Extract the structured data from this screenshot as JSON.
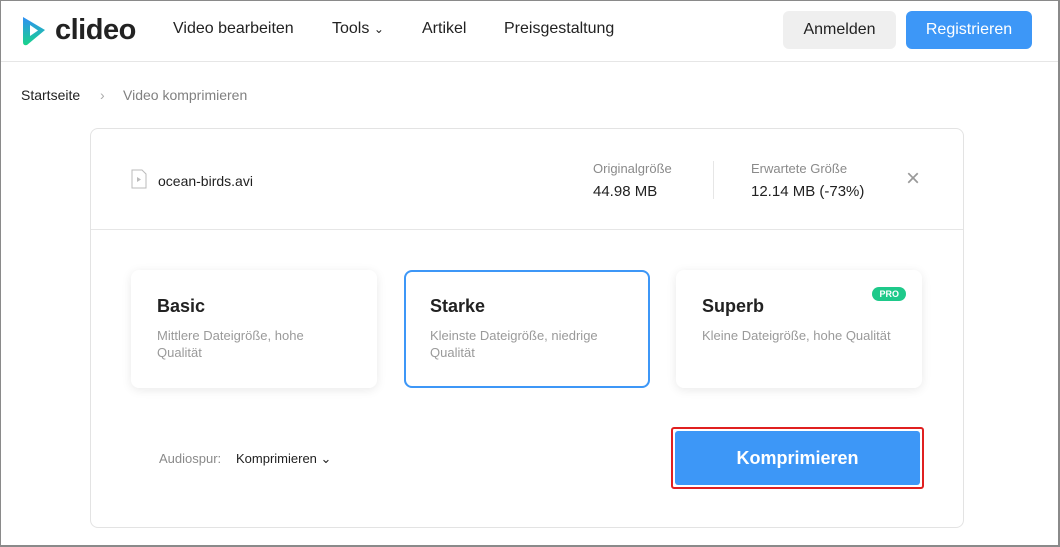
{
  "header": {
    "logo": "clideo",
    "nav": [
      "Video bearbeiten",
      "Tools",
      "Artikel",
      "Preisgestaltung"
    ],
    "login": "Anmelden",
    "register": "Registrieren"
  },
  "breadcrumb": {
    "home": "Startseite",
    "current": "Video komprimieren"
  },
  "file": {
    "name": "ocean-birds.avi",
    "original_label": "Originalgröße",
    "original_value": "44.98 MB",
    "expected_label": "Erwartete Größe",
    "expected_value": "12.14 MB (-73%)"
  },
  "options": [
    {
      "title": "Basic",
      "desc": "Mittlere Dateigröße, hohe Qualität"
    },
    {
      "title": "Starke",
      "desc": "Kleinste Dateigröße, niedrige Qualität",
      "selected": true
    },
    {
      "title": "Superb",
      "desc": "Kleine Dateigröße, hohe Qualität",
      "badge": "PRO"
    }
  ],
  "audio": {
    "label": "Audiospur:",
    "value": "Komprimieren"
  },
  "action": "Komprimieren"
}
